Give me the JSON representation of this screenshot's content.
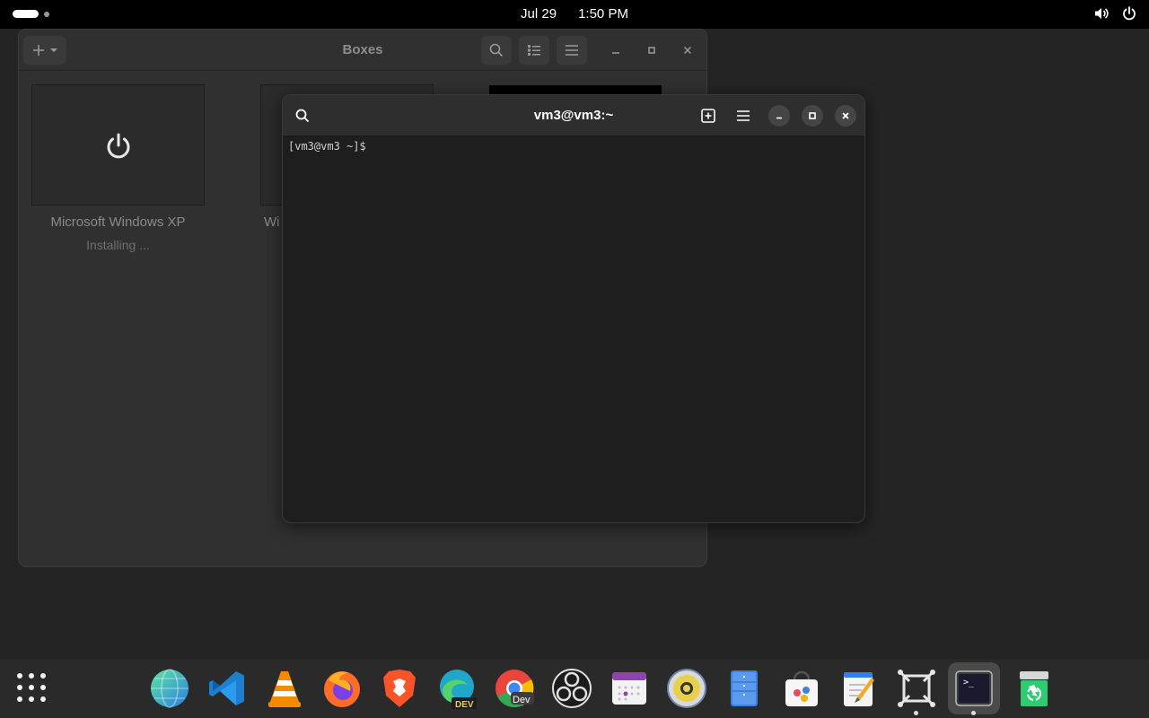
{
  "topbar": {
    "date": "Jul 29",
    "time": "1:50 PM",
    "icons": [
      "activities-indicator",
      "volume-icon",
      "power-icon"
    ]
  },
  "boxes": {
    "title": "Boxes",
    "vms": [
      {
        "name": "Microsoft Windows XP",
        "status": "Installing ..."
      },
      {
        "name": "Wi",
        "status": ""
      }
    ]
  },
  "terminal": {
    "title": "vm3@vm3:~",
    "prompt": "[vm3@vm3 ~]$"
  },
  "dock": {
    "apps": [
      {
        "name": "globe-browser",
        "color": "#3aa0e8"
      },
      {
        "name": "vscode",
        "color": "#2a8fd6"
      },
      {
        "name": "vlc",
        "color": "#f08a00"
      },
      {
        "name": "firefox",
        "color": "#ff7a1a"
      },
      {
        "name": "brave",
        "color": "#fb542b"
      },
      {
        "name": "edge-dev",
        "color": "#2bb3c7"
      },
      {
        "name": "chrome-dev",
        "color": "#e8453c"
      },
      {
        "name": "obs-studio",
        "color": "#1c1c1c"
      },
      {
        "name": "calendar",
        "color": "#8e44ad"
      },
      {
        "name": "speaker",
        "color": "#e8d14a"
      },
      {
        "name": "file-cabinet",
        "color": "#3b82e0"
      },
      {
        "name": "software-store",
        "color": "#f6f6f6"
      },
      {
        "name": "text-editor",
        "color": "#2f80ed"
      },
      {
        "name": "boxes",
        "color": "#e6e6e6"
      },
      {
        "name": "terminal",
        "color": "#1a1a1a"
      },
      {
        "name": "trash",
        "color": "#2ecc71"
      }
    ],
    "dev_badge": "DEV",
    "dev_badge_chrome": "Dev",
    "terminal_glyph": ">_"
  }
}
